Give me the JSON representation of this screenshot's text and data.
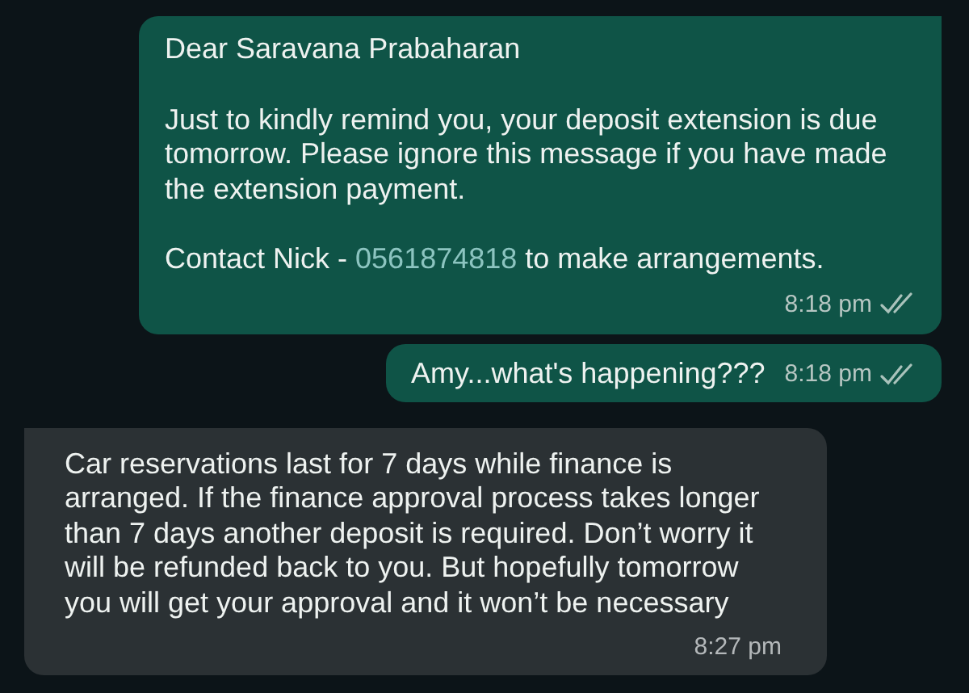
{
  "messages": [
    {
      "kind": "outgoing",
      "tail": true,
      "paragraphs": [
        {
          "parts": [
            {
              "text": "Dear Saravana Prabaharan"
            }
          ]
        },
        {
          "parts": [
            {
              "text": "Just to kindly remind you, your deposit extension is due tomorrow. Please ignore this message if you have made the extension payment."
            }
          ]
        },
        {
          "parts": [
            {
              "text": "Contact Nick - "
            },
            {
              "text": "0561874818",
              "kind": "link"
            },
            {
              "text": " to make arrangements."
            }
          ]
        }
      ],
      "time": "8:18 pm",
      "delivered": true,
      "read": false
    },
    {
      "kind": "outgoing",
      "tail": false,
      "paragraphs": [
        {
          "parts": [
            {
              "text": "Amy...what's happening???"
            }
          ]
        }
      ],
      "time": "8:18 pm",
      "delivered": true,
      "read": false
    },
    {
      "kind": "incoming",
      "tail": true,
      "paragraphs": [
        {
          "parts": [
            {
              "text": "Car reservations last for 7 days while finance is arranged. If the finance approval process takes longer than 7 days another deposit is required. Don’t worry it will be refunded back to you. But hopefully tomorrow you will get your approval and it won’t be necessary"
            }
          ]
        }
      ],
      "time": "8:27 pm"
    }
  ]
}
